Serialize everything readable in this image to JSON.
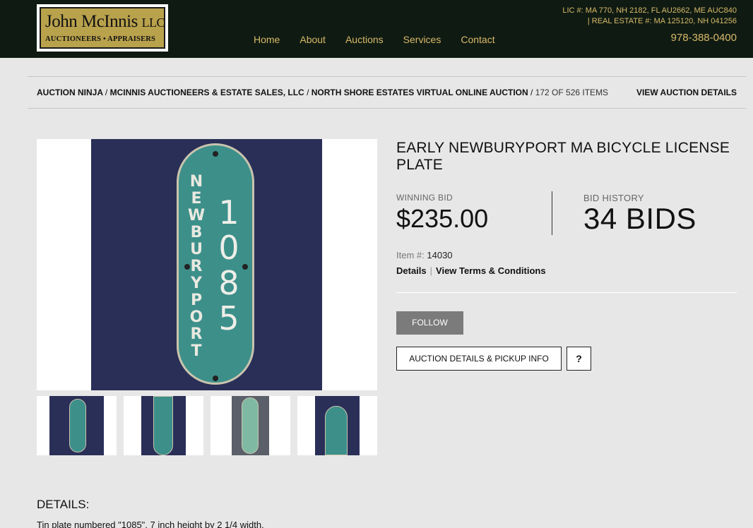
{
  "header": {
    "logo": {
      "name": "John McInnis",
      "suffix": "LLC",
      "tagline": "AUCTIONEERS • APPRAISERS"
    },
    "nav": [
      "Home",
      "About",
      "Auctions",
      "Services",
      "Contact"
    ],
    "license_line1": "LIC #: MA 770, NH 2182, FL AU2662, ME AUC840",
    "license_line2": "| REAL ESTATE #: MA 125120, NH 041256",
    "phone": "978-388-0400"
  },
  "breadcrumb": {
    "items": [
      "AUCTION NINJA",
      "MCINNIS AUCTIONEERS & ESTATE SALES, LLC",
      "NORTH SHORE ESTATES VIRTUAL ONLINE AUCTION"
    ],
    "separator": "/",
    "count": "172 OF 526 ITEMS",
    "view_details": "VIEW AUCTION DETAILS"
  },
  "item": {
    "title": "EARLY NEWBURYPORT MA BICYCLE LICENSE PLATE",
    "winning_bid_label": "WINNING BID",
    "winning_bid": "$235.00",
    "bid_history_label": "BID HISTORY",
    "bid_count": "34 BIDS",
    "item_no_label": "Item #:",
    "item_no": "14030",
    "details_link": "Details",
    "terms_link": "View Terms & Conditions",
    "follow_label": "FOLLOW",
    "pickup_label": "AUCTION DETAILS & PICKUP INFO",
    "help_label": "?"
  },
  "photo": {
    "plate_city": "NEWBURYPORT",
    "plate_number": "1085",
    "colors": {
      "plate": "#3d8f8a",
      "backdrop": "#2a2f58"
    }
  },
  "details": {
    "heading": "DETAILS:",
    "text": "Tin plate numbered \"1085\". 7 inch height by 2 1/4 width."
  }
}
